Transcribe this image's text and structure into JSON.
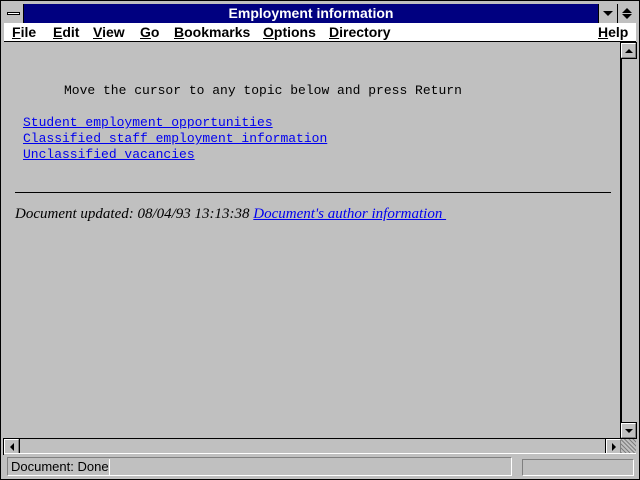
{
  "window": {
    "title": "Employment information"
  },
  "menubar": {
    "items": [
      {
        "mnemonic": "F",
        "rest": "ile"
      },
      {
        "mnemonic": "E",
        "rest": "dit"
      },
      {
        "mnemonic": "V",
        "rest": "iew"
      },
      {
        "mnemonic": "G",
        "rest": "o"
      },
      {
        "mnemonic": "B",
        "rest": "ookmarks"
      },
      {
        "mnemonic": "O",
        "rest": "ptions"
      },
      {
        "mnemonic": "D",
        "rest": "irectory"
      },
      {
        "mnemonic": "H",
        "rest": "elp"
      }
    ]
  },
  "content": {
    "prompt": "Move the cursor to any topic below and press Return",
    "links": [
      "Student employment opportunities",
      "Classified staff employment information",
      "Unclassified vacancies"
    ],
    "footer": {
      "updated_text": "Document updated: 08/04/93 13:13:38 ",
      "author_link": "Document's author information "
    }
  },
  "statusbar": {
    "text": "Document: Done",
    "progress_percent": 0
  },
  "colors": {
    "title_bar": "#000080",
    "link": "#0000ee",
    "background": "#c0c0c0"
  },
  "icons": {
    "system_menu": "system-menu-icon",
    "minimize": "minimize-icon",
    "maximize": "maximize-icon",
    "scroll_up": "arrow-up-icon",
    "scroll_down": "arrow-down-icon",
    "scroll_left": "arrow-left-icon",
    "scroll_right": "arrow-right-icon",
    "size_grip": "size-grip-icon"
  }
}
